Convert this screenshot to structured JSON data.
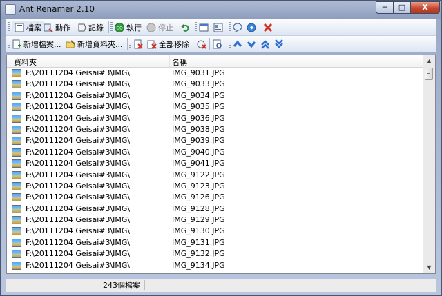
{
  "window": {
    "title": "Ant Renamer 2.10",
    "min_label": "─",
    "max_label": "□",
    "close_label": "X"
  },
  "toolbar1": {
    "files_label": "檔案",
    "actions_label": "動作",
    "log_label": "記錄",
    "run_label": "執行",
    "stop_label": "停止",
    "go_icon_text": "GO"
  },
  "toolbar2": {
    "add_files_label": "新增檔案...",
    "add_folders_label": "新增資料夾...",
    "remove_all_label": "全部移除"
  },
  "list": {
    "headers": {
      "folder": "資料夾",
      "name": "名稱"
    },
    "rows": [
      {
        "folder": "F:\\20111204 Geisai#3\\IMG\\",
        "name": "IMG_9031.JPG"
      },
      {
        "folder": "F:\\20111204 Geisai#3\\IMG\\",
        "name": "IMG_9033.JPG"
      },
      {
        "folder": "F:\\20111204 Geisai#3\\IMG\\",
        "name": "IMG_9034.JPG"
      },
      {
        "folder": "F:\\20111204 Geisai#3\\IMG\\",
        "name": "IMG_9035.JPG"
      },
      {
        "folder": "F:\\20111204 Geisai#3\\IMG\\",
        "name": "IMG_9036.JPG"
      },
      {
        "folder": "F:\\20111204 Geisai#3\\IMG\\",
        "name": "IMG_9038.JPG"
      },
      {
        "folder": "F:\\20111204 Geisai#3\\IMG\\",
        "name": "IMG_9039.JPG"
      },
      {
        "folder": "F:\\20111204 Geisai#3\\IMG\\",
        "name": "IMG_9040.JPG"
      },
      {
        "folder": "F:\\20111204 Geisai#3\\IMG\\",
        "name": "IMG_9041.JPG"
      },
      {
        "folder": "F:\\20111204 Geisai#3\\IMG\\",
        "name": "IMG_9122.JPG"
      },
      {
        "folder": "F:\\20111204 Geisai#3\\IMG\\",
        "name": "IMG_9123.JPG"
      },
      {
        "folder": "F:\\20111204 Geisai#3\\IMG\\",
        "name": "IMG_9126.JPG"
      },
      {
        "folder": "F:\\20111204 Geisai#3\\IMG\\",
        "name": "IMG_9128.JPG"
      },
      {
        "folder": "F:\\20111204 Geisai#3\\IMG\\",
        "name": "IMG_9129.JPG"
      },
      {
        "folder": "F:\\20111204 Geisai#3\\IMG\\",
        "name": "IMG_9130.JPG"
      },
      {
        "folder": "F:\\20111204 Geisai#3\\IMG\\",
        "name": "IMG_9131.JPG"
      },
      {
        "folder": "F:\\20111204 Geisai#3\\IMG\\",
        "name": "IMG_9132.JPG"
      },
      {
        "folder": "F:\\20111204 Geisai#3\\IMG\\",
        "name": "IMG_9134.JPG"
      }
    ]
  },
  "status": {
    "count_text": "243個檔案"
  },
  "colors": {
    "accent": "#3a7bd5",
    "title_bar": "#9eacc9",
    "close": "#c8452c"
  }
}
